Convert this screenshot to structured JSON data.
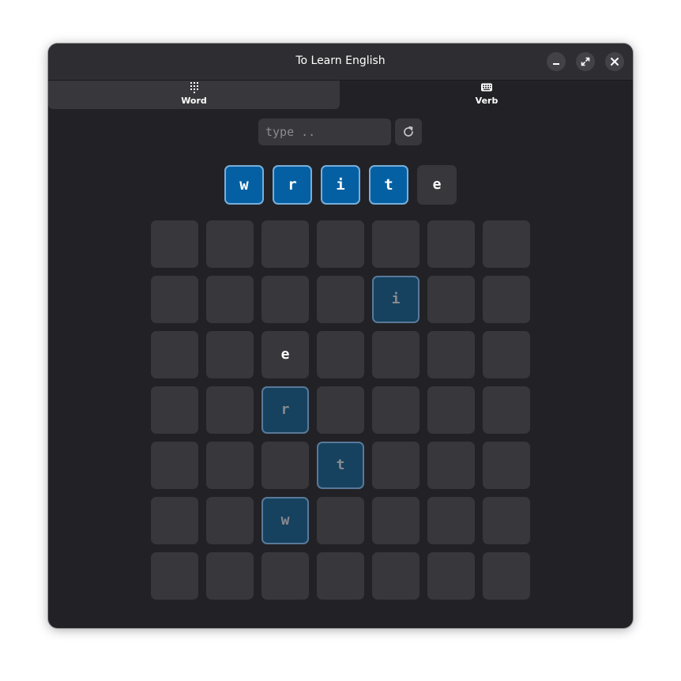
{
  "window": {
    "title": "To Learn English"
  },
  "tabs": [
    {
      "label": "Word",
      "icon": "keypad-grid-icon",
      "active": true
    },
    {
      "label": "Verb",
      "icon": "keyboard-icon",
      "active": false
    }
  ],
  "input": {
    "placeholder": "type ..",
    "value": ""
  },
  "refresh": {
    "icon": "refresh-icon"
  },
  "word_tiles": [
    {
      "letter": "w",
      "state": "found"
    },
    {
      "letter": "r",
      "state": "found"
    },
    {
      "letter": "i",
      "state": "found"
    },
    {
      "letter": "t",
      "state": "found"
    },
    {
      "letter": "e",
      "state": "pending"
    }
  ],
  "grid": {
    "rows": 7,
    "cols": 7,
    "cells": [
      {
        "row": 1,
        "col": 4,
        "letter": "i",
        "state": "hit"
      },
      {
        "row": 2,
        "col": 2,
        "letter": "e",
        "state": "plain"
      },
      {
        "row": 3,
        "col": 2,
        "letter": "r",
        "state": "hit"
      },
      {
        "row": 4,
        "col": 3,
        "letter": "t",
        "state": "hit"
      },
      {
        "row": 5,
        "col": 2,
        "letter": "w",
        "state": "hit"
      }
    ]
  },
  "colors": {
    "window_bg": "#222226",
    "tile_bg": "#38383c",
    "found_tile": "#0560a3",
    "found_border": "#78aeda",
    "hit_cell": "#16425f",
    "hit_border": "#59799a"
  }
}
